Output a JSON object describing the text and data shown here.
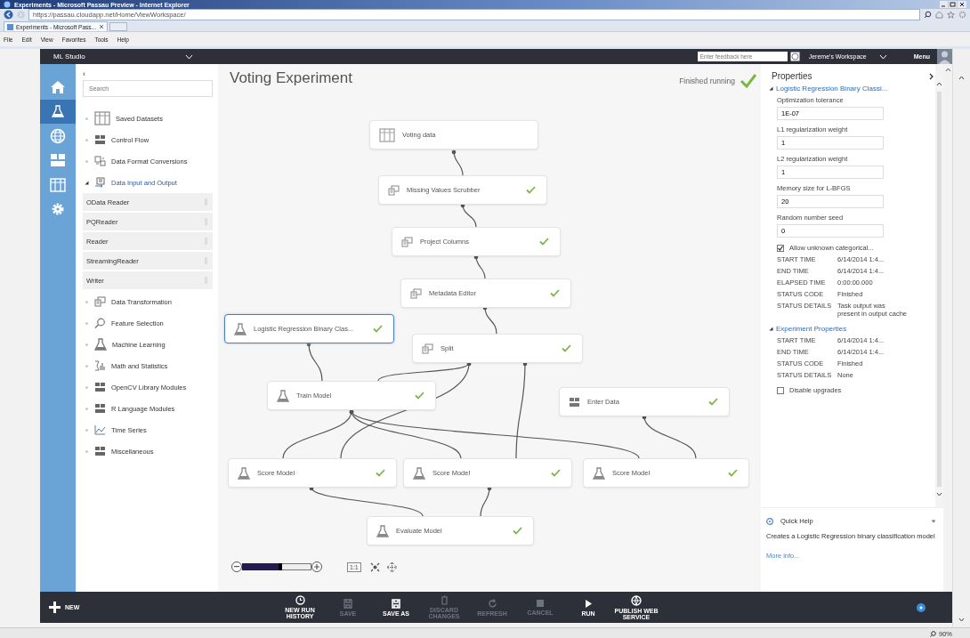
{
  "browser": {
    "title": "Experiments - Microsoft Passau Preview - Internet Explorer",
    "address": "https://passau.cloudapp.net/Home/ViewWorkspace/",
    "tab": "Experiments - Microsoft Pass...",
    "menu": [
      "File",
      "Edit",
      "View",
      "Favorites",
      "Tools",
      "Help"
    ]
  },
  "header": {
    "app_name": "ML Studio",
    "feedback": {
      "placeholder": "Enter feedback here"
    },
    "workspace": "Jereme's Workspace",
    "menu": "Menu"
  },
  "nav": [
    {
      "selected": false
    },
    {
      "selected": true
    },
    {
      "selected": false
    },
    {
      "selected": false
    },
    {
      "selected": false
    },
    {
      "selected": false
    }
  ],
  "palette": {
    "collapse": "‹",
    "search": {
      "placeholder": "Search"
    },
    "items": [
      {
        "label": "Saved Datasets",
        "expanded": false
      },
      {
        "label": "Control Flow",
        "expanded": false
      },
      {
        "label": "Data Format Conversions",
        "expanded": false
      },
      {
        "label": "Data Input and Output",
        "expanded": true,
        "children": [
          {
            "label": "OData Reader"
          },
          {
            "label": "PQReader"
          },
          {
            "label": "Reader"
          },
          {
            "label": "StreamingReader"
          },
          {
            "label": "Writer"
          }
        ]
      },
      {
        "label": "Data Transformation",
        "expanded": false
      },
      {
        "label": "Feature Selection",
        "expanded": false
      },
      {
        "label": "Machine Learning",
        "expanded": false
      },
      {
        "label": "Math and Statistics",
        "expanded": false
      },
      {
        "label": "OpenCV Library Modules",
        "expanded": false
      },
      {
        "label": "R Language Modules",
        "expanded": false
      },
      {
        "label": "Time Series",
        "expanded": false
      },
      {
        "label": "Miscellaneous",
        "expanded": false
      }
    ]
  },
  "canvas": {
    "title": "Voting Experiment",
    "status": "Finished running",
    "nodes": [
      {
        "label": "Voting data",
        "finished": false,
        "selected": false
      },
      {
        "label": "Missing Values Scrubber",
        "finished": true,
        "selected": false
      },
      {
        "label": "Project Columns",
        "finished": true,
        "selected": false
      },
      {
        "label": "Metadata Editor",
        "finished": true,
        "selected": false
      },
      {
        "label": "Logistic Regression Binary Clas...",
        "finished": true,
        "selected": true
      },
      {
        "label": "Split",
        "finished": true,
        "selected": false
      },
      {
        "label": "Train Model",
        "finished": true,
        "selected": false
      },
      {
        "label": "Enter Data",
        "finished": true,
        "selected": false
      },
      {
        "label": "Score Model",
        "finished": true,
        "selected": false
      },
      {
        "label": "Score Model",
        "finished": true,
        "selected": false
      },
      {
        "label": "Score Model",
        "finished": true,
        "selected": false
      },
      {
        "label": "Evaluate Model",
        "finished": true,
        "selected": false
      }
    ],
    "zoom": {
      "level": 0.55,
      "actual_size": "1:1"
    }
  },
  "properties": {
    "title": "Properties",
    "module": {
      "title": "Logistic Regression Binary Classi...",
      "expanded": true,
      "fields": [
        {
          "label": "Optimization tolerance",
          "value": "1E-07"
        },
        {
          "label": "L1 regularization weight",
          "value": "1"
        },
        {
          "label": "L2 regularization weight",
          "value": "1"
        },
        {
          "label": "Memory size for L-BFGS",
          "value": "20"
        },
        {
          "label": "Random number seed",
          "value": "0"
        }
      ],
      "checkbox": {
        "label": "Allow unknown categorical...",
        "checked": true
      },
      "stats": [
        {
          "label": "START TIME",
          "value": "6/14/2014 1:4..."
        },
        {
          "label": "END TIME",
          "value": "6/14/2014 1:4..."
        },
        {
          "label": "ELAPSED TIME",
          "value": "0:00:00.000"
        },
        {
          "label": "STATUS CODE",
          "value": "Finished"
        },
        {
          "label": "STATUS DETAILS",
          "value": "Task output was present in output cache"
        }
      ]
    },
    "experiment": {
      "title": "Experiment Properties",
      "expanded": true,
      "stats": [
        {
          "label": "START TIME",
          "value": "6/14/2014 1:4..."
        },
        {
          "label": "END TIME",
          "value": "6/14/2014 1:4..."
        },
        {
          "label": "STATUS CODE",
          "value": "Finished"
        },
        {
          "label": "STATUS DETAILS",
          "value": "None"
        }
      ],
      "checkbox": {
        "label": "Disable upgrades",
        "checked": false
      }
    },
    "quick_help": {
      "title": "Quick Help",
      "text": "Creates a Logistic Regression binary classification model",
      "link": "More info..."
    }
  },
  "commands": {
    "new": "NEW",
    "items": [
      {
        "label": "NEW RUN HISTORY",
        "disabled": false
      },
      {
        "label": "SAVE",
        "disabled": true
      },
      {
        "label": "SAVE AS",
        "disabled": false
      },
      {
        "label": "DISCARD CHANGES",
        "disabled": true
      },
      {
        "label": "REFRESH",
        "disabled": true
      },
      {
        "label": "CANCEL",
        "disabled": true
      },
      {
        "label": "RUN",
        "disabled": false
      },
      {
        "label": "PUBLISH WEB SERVICE",
        "disabled": false
      }
    ]
  },
  "status_bar": {
    "zoom": "90%"
  }
}
